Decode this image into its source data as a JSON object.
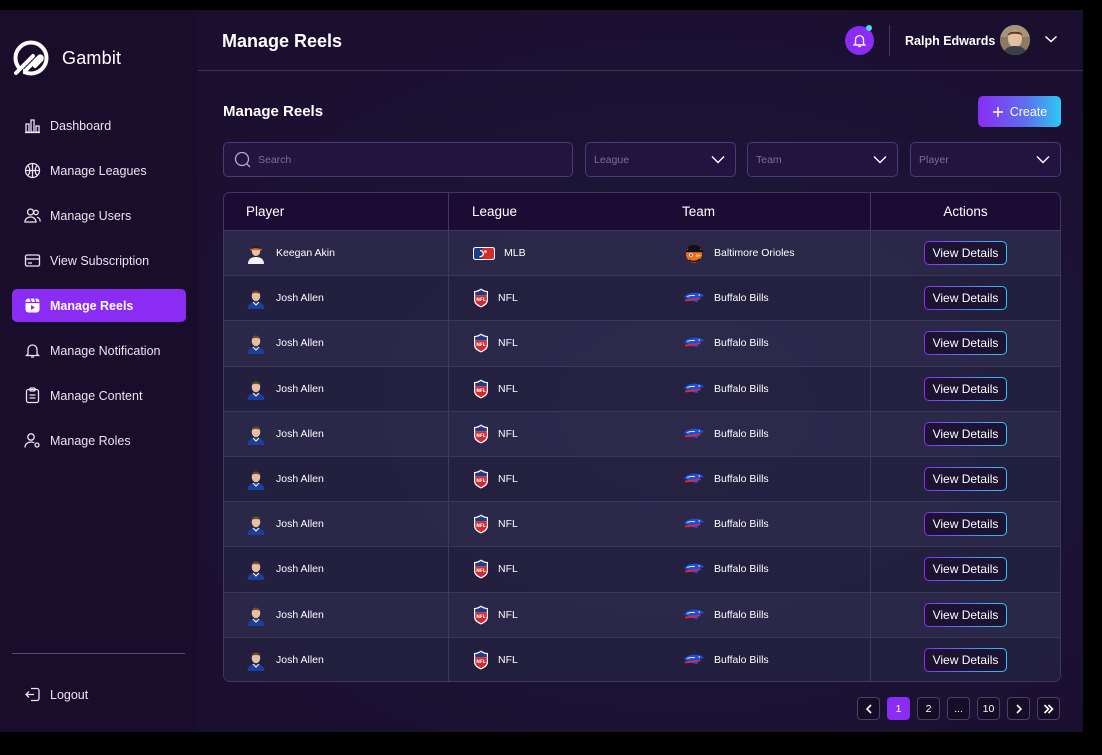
{
  "brand": {
    "name": "Gambit"
  },
  "sidebar": {
    "items": [
      {
        "label": "Dashboard",
        "icon": "bar-chart-icon"
      },
      {
        "label": "Manage Leagues",
        "icon": "basketball-icon"
      },
      {
        "label": "Manage Users",
        "icon": "users-icon"
      },
      {
        "label": "View Subscription",
        "icon": "card-icon"
      },
      {
        "label": "Manage Reels",
        "icon": "reels-icon",
        "active": true
      },
      {
        "label": "Manage Notification",
        "icon": "bell-icon"
      },
      {
        "label": "Manage Content",
        "icon": "clipboard-icon"
      },
      {
        "label": "Manage Roles",
        "icon": "user-cog-icon"
      }
    ],
    "logout_label": "Logout"
  },
  "header": {
    "title": "Manage Reels",
    "user_name": "Ralph Edwards"
  },
  "main": {
    "section_title": "Manage Reels",
    "create_label": "Create",
    "search_placeholder": "Search",
    "filters": {
      "league": "League",
      "team": "Team",
      "player": "Player"
    }
  },
  "table": {
    "columns": {
      "player": "Player",
      "league": "League",
      "team": "Team",
      "actions": "Actions"
    },
    "rows": [
      {
        "player": "Keegan Akin",
        "league": "MLB",
        "team": "Baltimore Orioles",
        "action": "View Details"
      },
      {
        "player": "Josh Allen",
        "league": "NFL",
        "team": "Buffalo Bills",
        "action": "View Details"
      },
      {
        "player": "Josh Allen",
        "league": "NFL",
        "team": "Buffalo Bills",
        "action": "View Details"
      },
      {
        "player": "Josh Allen",
        "league": "NFL",
        "team": "Buffalo Bills",
        "action": "View Details"
      },
      {
        "player": "Josh Allen",
        "league": "NFL",
        "team": "Buffalo Bills",
        "action": "View Details"
      },
      {
        "player": "Josh Allen",
        "league": "NFL",
        "team": "Buffalo Bills",
        "action": "View Details"
      },
      {
        "player": "Josh Allen",
        "league": "NFL",
        "team": "Buffalo Bills",
        "action": "View Details"
      },
      {
        "player": "Josh Allen",
        "league": "NFL",
        "team": "Buffalo Bills",
        "action": "View Details"
      },
      {
        "player": "Josh Allen",
        "league": "NFL",
        "team": "Buffalo Bills",
        "action": "View Details"
      },
      {
        "player": "Josh Allen",
        "league": "NFL",
        "team": "Buffalo Bills",
        "action": "View Details"
      }
    ]
  },
  "pagination": {
    "pages": [
      "1",
      "2",
      "...",
      "10"
    ],
    "current": "1"
  },
  "colors": {
    "accent": "#8b2cf5",
    "accent_cyan": "#2ec9f0",
    "sidebar_bg": "#1a0d2c"
  }
}
